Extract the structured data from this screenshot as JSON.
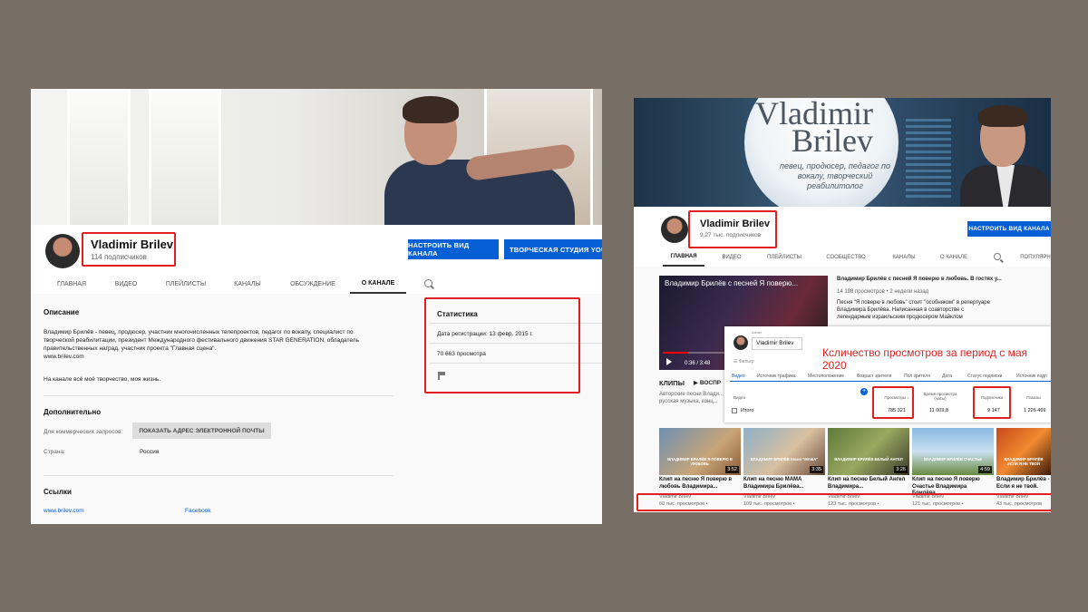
{
  "left": {
    "channel_name": "Vladimir Brilev",
    "subscribers": "114 подписчиков",
    "customize_button": "НАСТРОИТЬ ВИД КАНАЛА",
    "studio_button": "ТВОРЧЕСКАЯ СТУДИЯ YOUTUBE",
    "tabs": [
      "ГЛАВНАЯ",
      "ВИДЕО",
      "ПЛЕЙЛИСТЫ",
      "КАНАЛЫ",
      "ОБСУЖДЕНИЕ",
      "О КАНАЛЕ"
    ],
    "active_tab": "О КАНАЛЕ",
    "description_heading": "Описание",
    "description_lines": [
      "Владимир Брилёв - певец, продюсер, участник многочисленных телепроектов, педагог по вокалу, специалист по",
      "творческой реабилитации, президент Международного фестивального движения STAR GENERATION, обладатель",
      "правительственных наград, участник проекта \"Главная сцена\".",
      "www.brilev.com"
    ],
    "description_footer": "На канале всё моё творчество, моя жизнь.",
    "additional_heading": "Дополнительно",
    "business_label": "Для коммерческих запросов:",
    "show_email_button": "ПОКАЗАТЬ АДРЕС ЭЛЕКТРОННОЙ ПОЧТЫ",
    "country_label": "Страна:",
    "country_value": "Россия",
    "links_heading": "Ссылки",
    "links": [
      "www.brilev.com",
      "Facebook"
    ],
    "stats_heading": "Статистика",
    "registered": "Дата регистрации: 13 февр. 2015 г.",
    "views": "70 663 просмотра"
  },
  "right": {
    "banner_line1": "Vladimir",
    "banner_line2": "Brilev",
    "banner_tagline": "певец, продюсер, педагог по вокалу, творческий реабилитолог",
    "channel_name": "Vladimir Brilev",
    "subscribers": "9,27 тыс. подписчиков",
    "customize_button": "НАСТРОИТЬ ВИД КАНАЛА",
    "tabs": [
      "ГЛАВНАЯ",
      "ВИДЕО",
      "ПЛЕЙЛИСТЫ",
      "СООБЩЕСТВО",
      "КАНАЛЫ",
      "О КАНАЛЕ",
      "ПОПУЛЯРН"
    ],
    "active_tab": "ГЛАВНАЯ",
    "featured_overlay_title": "Владимир Брилёв с песней Я поверю...",
    "featured_time": "0:36 / 3:48",
    "featured_progress": 0.16,
    "featured_title": "Владимир Брилёв с песней Я поверю в любовь. В гостях у...",
    "featured_meta": "14 198 просмотров • 2 недели назад",
    "featured_desc": [
      "Песня \"Я поверю в любовь\" стоит \"особняком\" в репертуаре",
      "Владимира Брилёва. Написанная в соавторстве с",
      "легендарным израильским продюсером Майклом"
    ],
    "clips_heading": "КЛИПЫ",
    "clips_play_all": "ВОСПР",
    "clips_desc": [
      "Авторские песни Влади...",
      "русская музыка, конц..."
    ],
    "analytics": {
      "channel": "Vladimir Brilev",
      "title": "Ксличество просмотров за период с мая 2020",
      "filter": "Фильтр",
      "tabs": [
        "Видео",
        "Источник трафика",
        "Местоположение",
        "Возраст зрителя",
        "Пол зрителя",
        "Дата",
        "Статус подписки",
        "Источник подп"
      ],
      "col_video": "Видео",
      "col_views": "Просмотры",
      "col_watch": "Время просмотра (часы)",
      "col_subs": "Подписчики",
      "col_likes": "Показы",
      "row_label": "Итого",
      "views_total": "785 321",
      "watch_total": "11 009,8",
      "subs_total": "9 147",
      "impressions_total": "1 226 469"
    },
    "videos": [
      {
        "cap": "ВЛАДИМИР БРИЛЁВ Я ПОВЕРЮ В ЛЮБОВЬ",
        "duration": "3:52",
        "title": "Клип на песню Я поверю в любовь Владимира...",
        "channel": "Vladimir Brilev",
        "views": "60 тыс. просмотров •"
      },
      {
        "cap": "ВЛАДИМИР БРИЛЁВ песня \"МАМА\"",
        "duration": "3:35",
        "title": "Клип на песню МАМА Владимира Брилёва...",
        "channel": "Vladimir Brilev",
        "views": "109 тыс. просмотров •"
      },
      {
        "cap": "ВЛАДИМИР БРИЛЁВ БЕЛЫЙ АНГЕЛ",
        "duration": "3:26",
        "title": "Клип на песню Белый Ангел Владимира...",
        "channel": "Vladimir Brilev",
        "views": "123 тыс. просмотров •"
      },
      {
        "cap": "ВЛАДИМИР БРИЛЁВ СЧАСТЬЕ",
        "duration": "4:59",
        "title": "Клип на песню Я поверю Счастье Владимира Брилёва...",
        "channel": "Vladimir Brilev",
        "views": "121 тыс. просмотров •"
      },
      {
        "cap": "ВЛАДИМИР БРИЛЁВ ЕСЛИ Я НЕ ТВОЙ",
        "duration": "",
        "title": "Владимир Брилёв - Если я не твой.",
        "channel": "Vladimir Brilev",
        "views": "43 тыс. просмотров"
      }
    ]
  }
}
